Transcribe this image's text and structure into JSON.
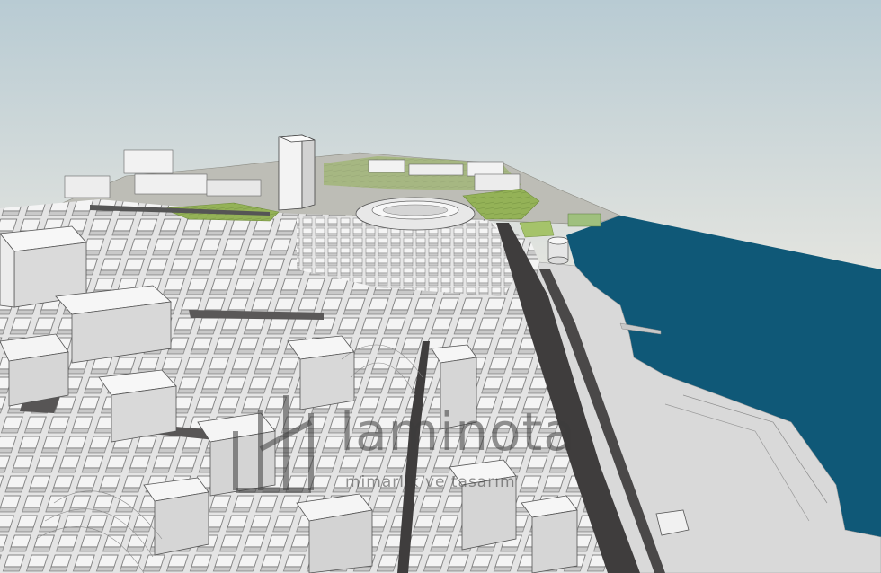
{
  "watermark": {
    "brand": "laminota",
    "tagline": "mimarlık ve tasarım"
  },
  "colors": {
    "sky_top": "#b8cbd3",
    "sky_bottom": "#e3e4df",
    "sea": "#0f5877",
    "buildings": "#eeeeee",
    "roads": "#3f3d3d",
    "parks": "#96b45a",
    "waterfront": "#d9d9d9"
  }
}
